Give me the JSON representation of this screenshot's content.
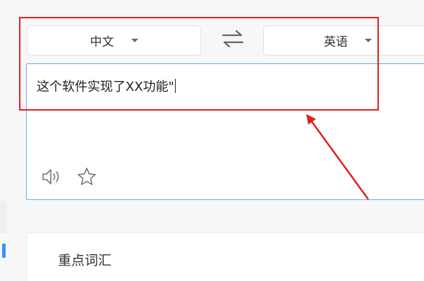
{
  "languages": {
    "source_label": "中文",
    "target_label": "英语"
  },
  "input": {
    "text": "这个软件实现了XX功能\""
  },
  "icons": {
    "swap": "swap-arrows-icon",
    "speaker": "speaker-icon",
    "favorite": "star-icon",
    "dropdown": "caret-down-icon"
  },
  "vocab": {
    "title": "重点词汇"
  },
  "colors": {
    "annotation": "#e02020",
    "focus_border": "#6da7f0",
    "accent": "#3d8ef7"
  }
}
